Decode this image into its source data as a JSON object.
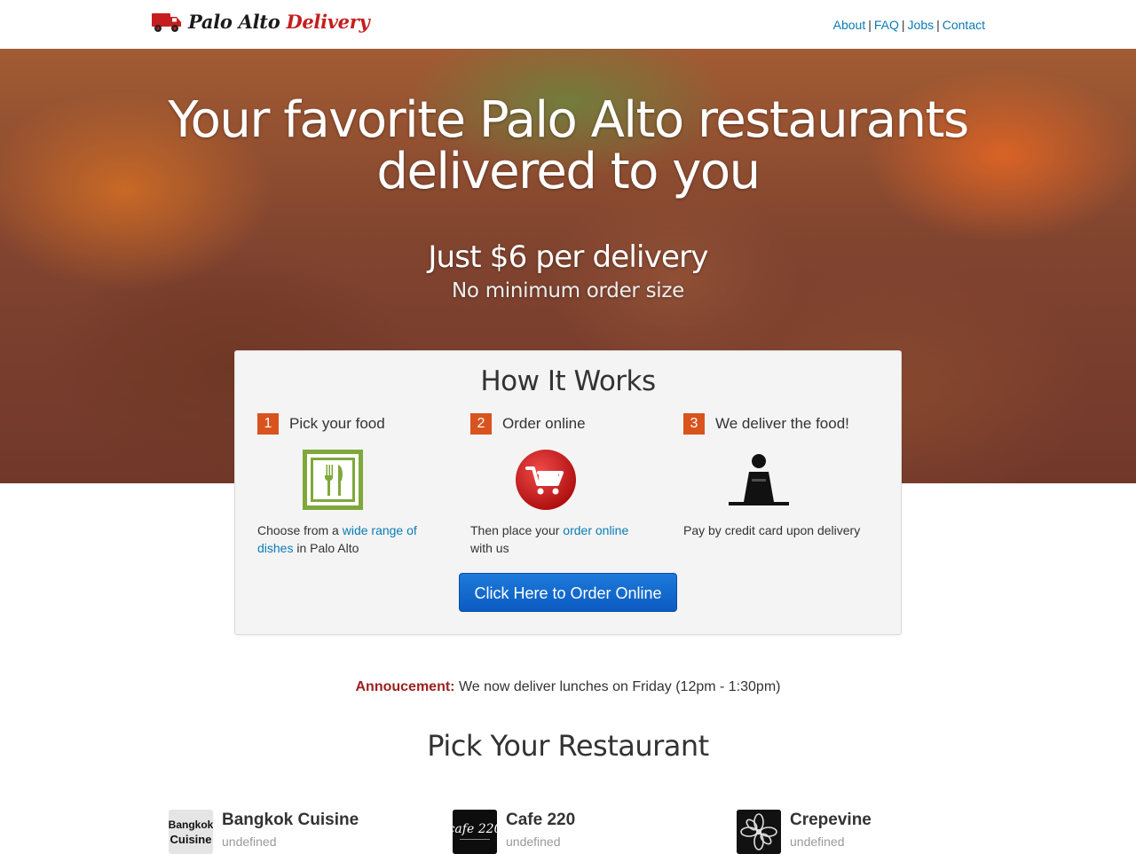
{
  "header": {
    "logo_text_1": "Palo Alto",
    "logo_text_2": "Delivery",
    "nav": [
      {
        "label": "About"
      },
      {
        "label": "FAQ"
      },
      {
        "label": "Jobs"
      },
      {
        "label": "Contact"
      }
    ],
    "nav_separator": "|"
  },
  "hero": {
    "title_line1": "Your favorite Palo Alto restaurants",
    "title_line2": "delivered to you",
    "price": "Just $6 per delivery",
    "subtitle": "No minimum order size"
  },
  "how_it_works": {
    "title": "How It Works",
    "steps": [
      {
        "number": "1",
        "title": "Pick your food",
        "icon": "fork-knife-icon",
        "desc_pre": "Choose from a ",
        "desc_link": "wide range of dishes",
        "desc_post": " in Palo Alto"
      },
      {
        "number": "2",
        "title": "Order online",
        "icon": "shopping-cart-icon",
        "desc_pre": "Then place your ",
        "desc_link": "order online",
        "desc_post": " with us"
      },
      {
        "number": "3",
        "title": "We deliver the food!",
        "icon": "person-icon",
        "desc_pre": "Pay by credit card upon delivery",
        "desc_link": "",
        "desc_post": ""
      }
    ],
    "order_button": "Click Here to Order Online"
  },
  "announcement": {
    "label": "Annoucement:",
    "text": " We now deliver lunches on Friday (12pm - 1:30pm)"
  },
  "restaurants": {
    "title": "Pick Your Restaurant",
    "items": [
      {
        "name": "Bangkok Cuisine",
        "sub": "undefined",
        "logo_text_1": "Bangkok",
        "logo_text_2": "Cuisine"
      },
      {
        "name": "Cafe 220",
        "sub": "undefined",
        "logo_text_1": "cafe 220"
      },
      {
        "name": "Crepevine",
        "sub": "undefined"
      }
    ]
  },
  "colors": {
    "link": "#0a7bb5",
    "step_number_bg": "#d9531e",
    "button": "#0b5bc2",
    "announcement_label": "#9b1f1f",
    "logo_accent": "#c41e1e"
  }
}
